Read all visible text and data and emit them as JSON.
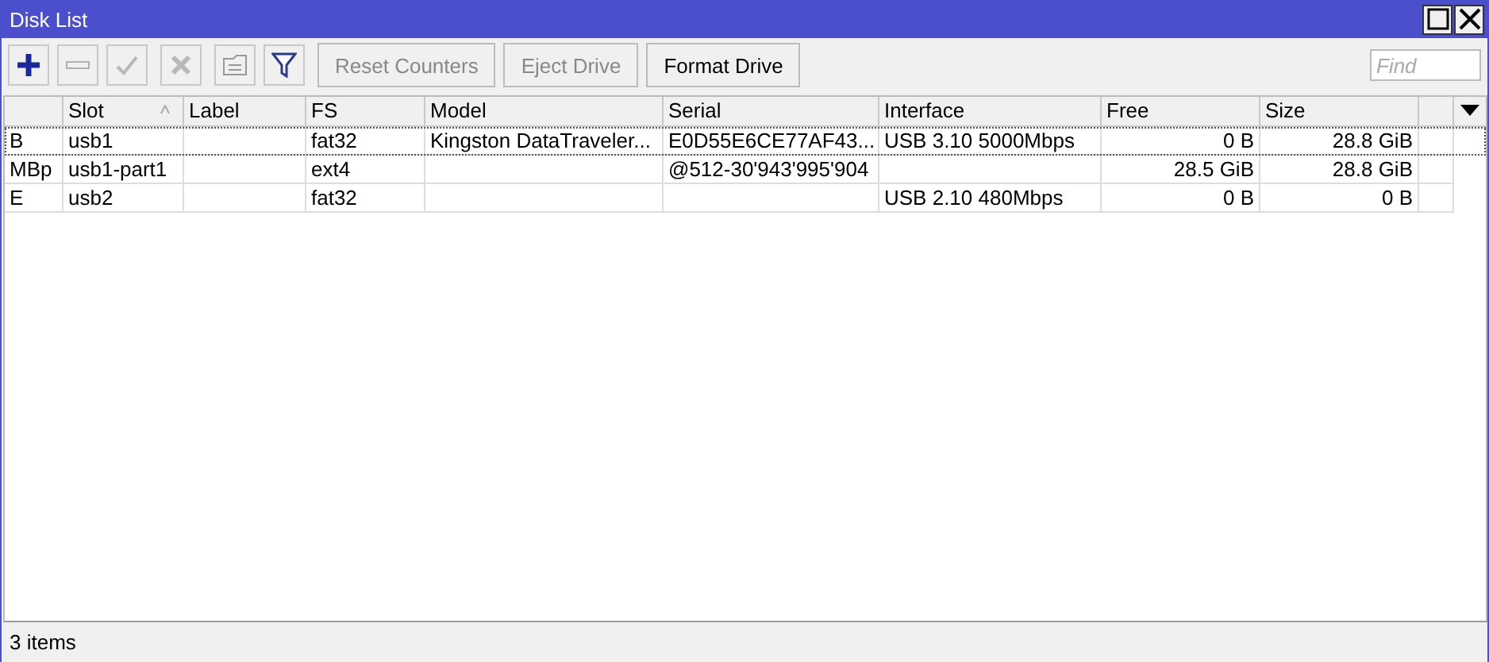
{
  "window": {
    "title": "Disk List",
    "controls": [
      {
        "kind": "maximize"
      },
      {
        "kind": "close"
      }
    ]
  },
  "toolbar": {
    "icon_buttons": [
      {
        "kind": "add",
        "disabled": false
      },
      {
        "kind": "remove",
        "disabled": true
      },
      {
        "kind": "enable",
        "disabled": true
      },
      {
        "kind": "disable",
        "disabled": true
      },
      {
        "kind": "comment",
        "disabled": true
      },
      {
        "kind": "filter",
        "disabled": false
      }
    ],
    "buttons": [
      {
        "label": "Reset Counters",
        "disabled": true
      },
      {
        "label": "Eject Drive",
        "disabled": true
      },
      {
        "label": "Format Drive",
        "disabled": false
      }
    ],
    "search": {
      "placeholder": "Find"
    }
  },
  "table": {
    "columns": [
      {
        "label": "Slot",
        "sorted": true
      },
      {
        "label": "Label",
        "sorted": false
      },
      {
        "label": "FS",
        "sorted": false
      },
      {
        "label": "Model",
        "sorted": false
      },
      {
        "label": "Serial",
        "sorted": false
      },
      {
        "label": "Interface",
        "sorted": false
      },
      {
        "label": "Free",
        "sorted": false
      },
      {
        "label": "Size",
        "sorted": false
      }
    ],
    "rows": [
      {
        "selected": true,
        "flags": "B",
        "slot": "usb1",
        "fs": "fat32",
        "model": "Kingston DataTraveler...",
        "serial": "E0D55E6CE77AF43...",
        "interface": "USB 3.10 5000Mbps",
        "free": "0 B",
        "size": "28.8 GiB"
      },
      {
        "selected": false,
        "flags": "MBp",
        "slot": "usb1-part1",
        "fs": "ext4",
        "serial": "@512-30'943'995'904",
        "free": "28.5 GiB",
        "size": "28.8 GiB"
      },
      {
        "selected": false,
        "flags": "E",
        "slot": "usb2",
        "fs": "fat32",
        "interface": "USB 2.10 480Mbps",
        "free": "0 B",
        "size": "0 B"
      }
    ]
  },
  "status_bar": {
    "text": "3 items"
  }
}
